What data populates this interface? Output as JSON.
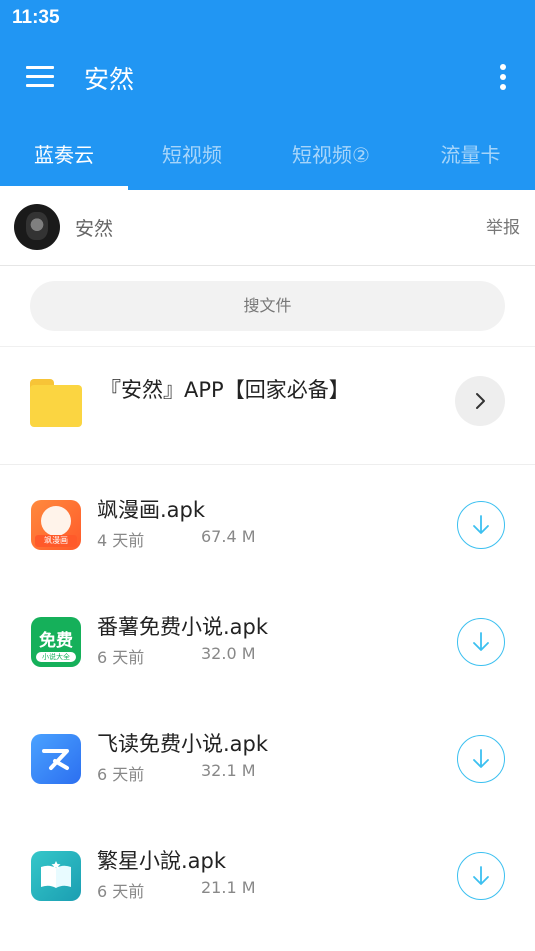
{
  "status_bar": {
    "time": "11:35"
  },
  "app_bar": {
    "title": "安然"
  },
  "tabs": [
    {
      "label": "蓝奏云",
      "active": true
    },
    {
      "label": "短视频",
      "active": false
    },
    {
      "label": "短视频②",
      "active": false
    },
    {
      "label": "流量卡",
      "active": false
    }
  ],
  "user": {
    "name": "安然",
    "report_label": "举报"
  },
  "search": {
    "placeholder": "搜文件"
  },
  "folder": {
    "name": "『安然』APP【回家必备】",
    "icon": "folder-icon"
  },
  "files": [
    {
      "name": "飒漫画.apk",
      "date": "4 天前",
      "size": "67.4 M",
      "icon": "manga-app-icon"
    },
    {
      "name": "番薯免费小说.apk",
      "date": "6 天前",
      "size": "32.0 M",
      "icon": "fanshu-app-icon",
      "icon_text": "免费",
      "icon_subtext": "小说大全"
    },
    {
      "name": "飞读免费小说.apk",
      "date": "6 天前",
      "size": "32.1 M",
      "icon": "feidu-app-icon"
    },
    {
      "name": "繁星小說.apk",
      "date": "6 天前",
      "size": "21.1 M",
      "icon": "fanxing-app-icon"
    }
  ],
  "colors": {
    "primary": "#2196F3",
    "download_accent": "#3cc0f0"
  }
}
